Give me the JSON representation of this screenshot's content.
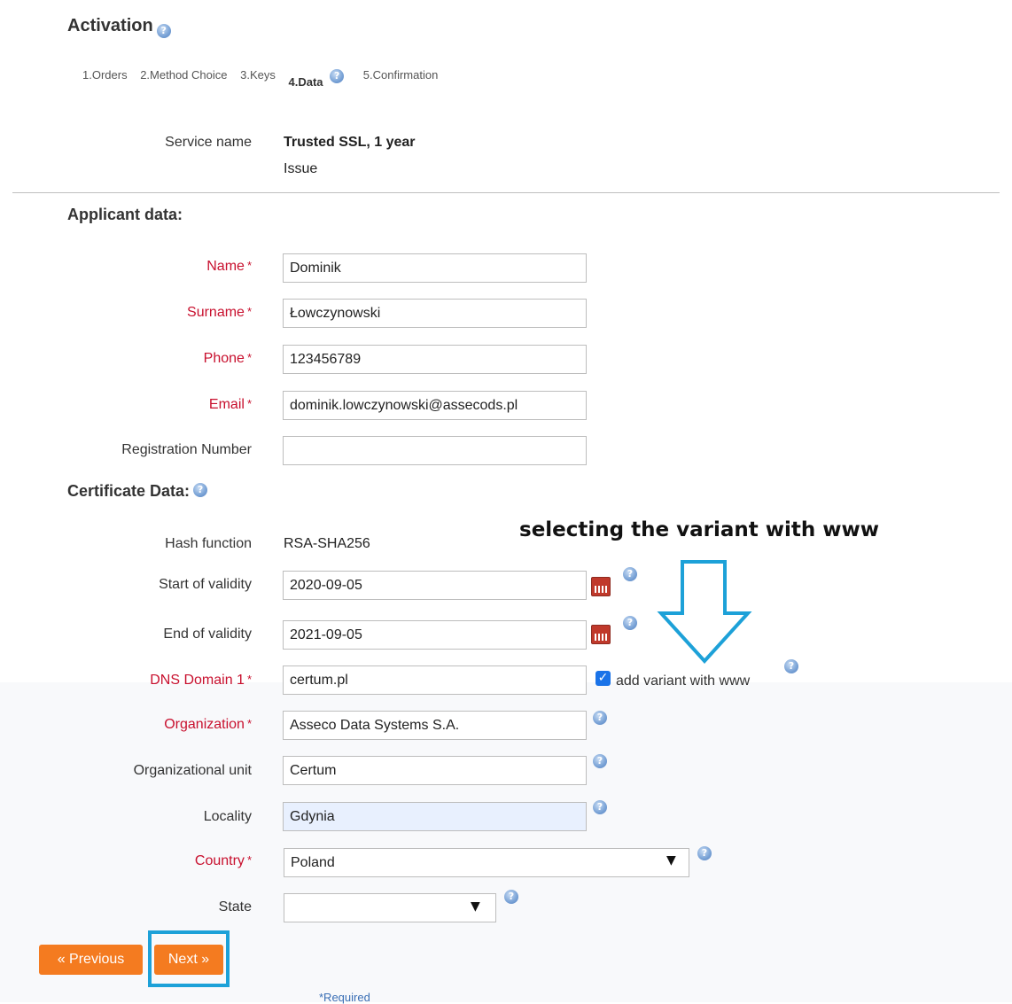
{
  "page": {
    "title": "Activation"
  },
  "steps": [
    {
      "label": "1.Orders"
    },
    {
      "label": "2.Method Choice"
    },
    {
      "label": "3.Keys"
    },
    {
      "label": "4.Data"
    },
    {
      "label": "5.Confirmation"
    }
  ],
  "service": {
    "name_label": "Service name",
    "name_value": "Trusted SSL, 1 year",
    "type_value": "Issue"
  },
  "applicant": {
    "heading": "Applicant data:",
    "name": {
      "label": "Name",
      "value": "Dominik"
    },
    "surname": {
      "label": "Surname",
      "value": "Łowczynowski"
    },
    "phone": {
      "label": "Phone",
      "value": "123456789"
    },
    "email": {
      "label": "Email",
      "value": "dominik.lowczynowski@assecods.pl"
    },
    "registration": {
      "label": "Registration Number",
      "value": ""
    }
  },
  "certificate": {
    "heading": "Certificate Data:",
    "hash": {
      "label": "Hash function",
      "value": "RSA-SHA256"
    },
    "start": {
      "label": "Start of validity",
      "value": "2020-09-05"
    },
    "end": {
      "label": "End of validity",
      "value": "2021-09-05"
    },
    "dns": {
      "label": "DNS Domain 1",
      "value": "certum.pl",
      "www_label": "add variant with www",
      "www_checked": true
    },
    "organization": {
      "label": "Organization",
      "value": "Asseco Data Systems S.A."
    },
    "unit": {
      "label": "Organizational unit",
      "value": "Certum"
    },
    "locality": {
      "label": "Locality",
      "value": "Gdynia"
    },
    "country": {
      "label": "Country",
      "value": "Poland"
    },
    "state": {
      "label": "State",
      "value": ""
    }
  },
  "required_mark": "*",
  "buttons": {
    "previous": "« Previous",
    "next": "Next »"
  },
  "required_note": "*Required",
  "annotation": {
    "text": "selecting the variant with www"
  },
  "colors": {
    "required": "#c8102e",
    "button": "#f47b20",
    "highlight": "#1da1d8",
    "help_icon": "#7ea6d8"
  },
  "icons": {
    "help": "help-icon",
    "calendar": "calendar-icon",
    "arrow": "arrow-down-outline-icon"
  }
}
